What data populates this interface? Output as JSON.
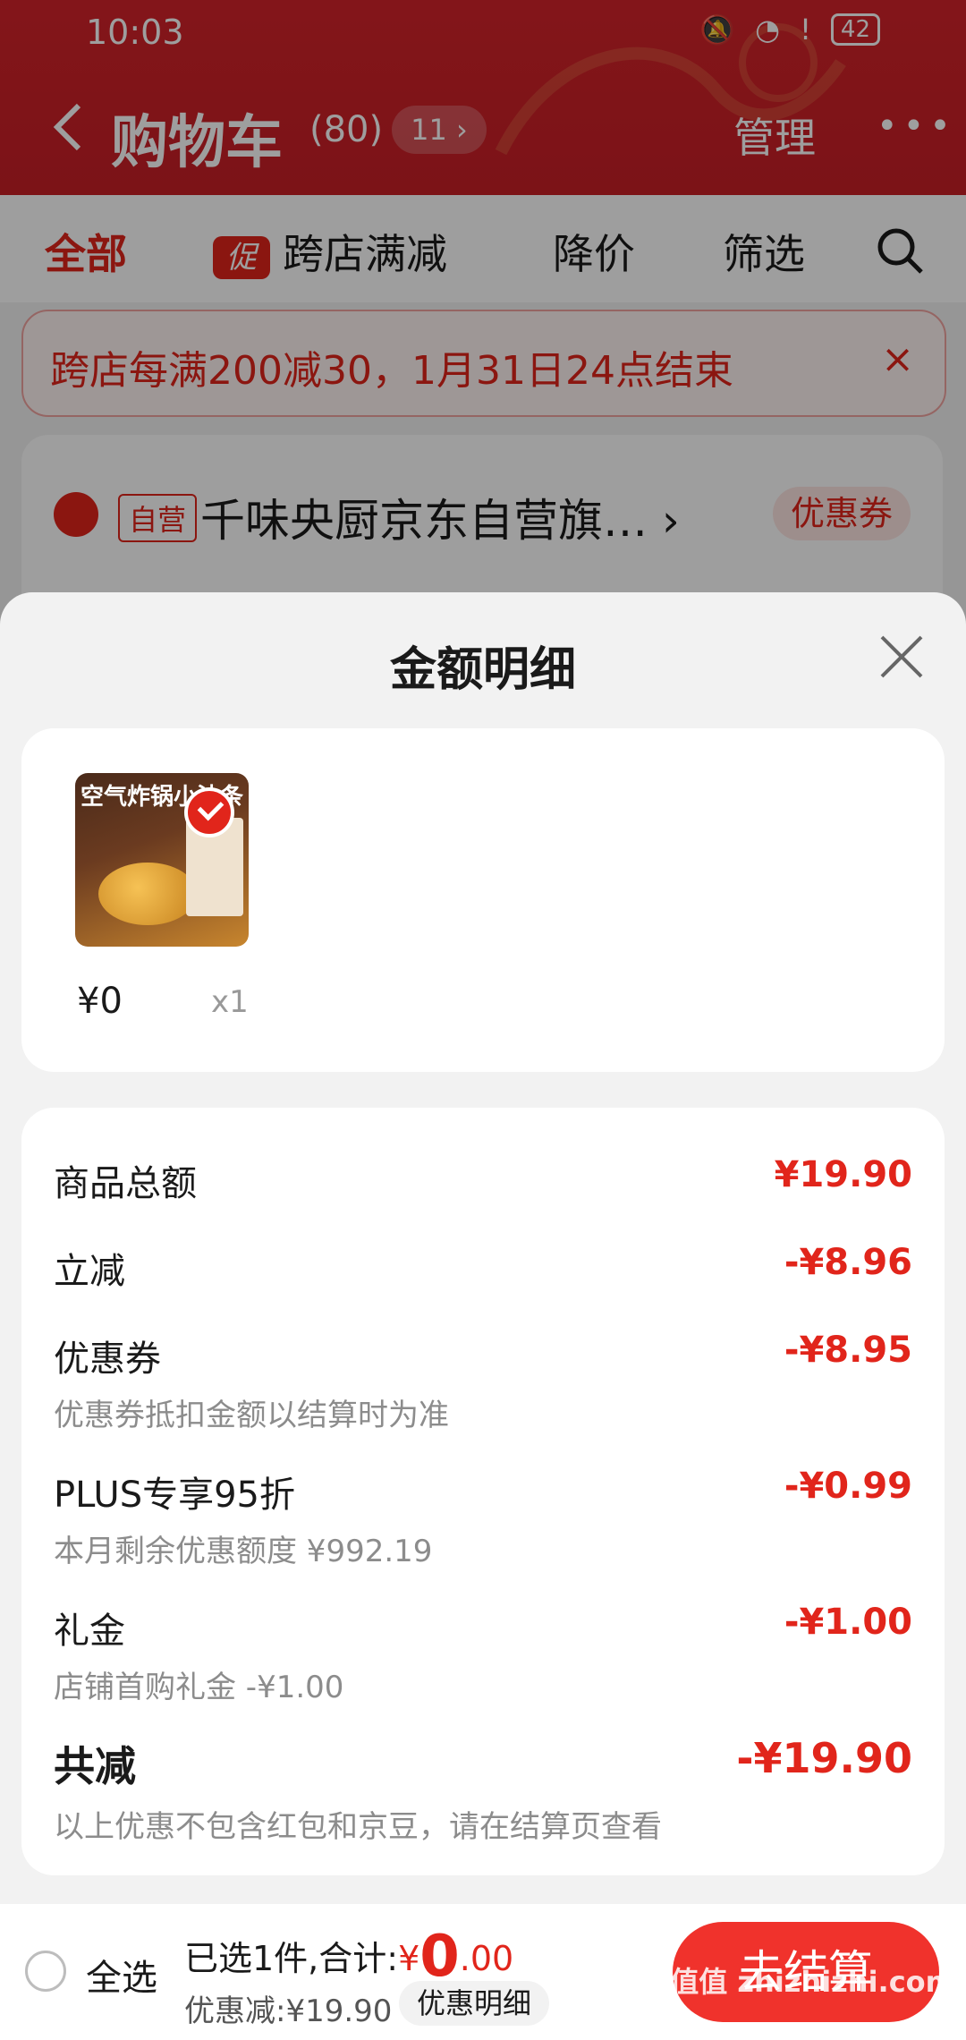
{
  "status_bar": {
    "time": "10:03",
    "battery": "42"
  },
  "nav": {
    "title": "购物车",
    "count": "(80)",
    "pill": "11 ›",
    "manage": "管理",
    "more": "•••"
  },
  "tabs": {
    "all": "全部",
    "promo_badge": "促",
    "cross_store": "跨店满减",
    "price_drop": "降价",
    "filter": "筛选"
  },
  "notice": {
    "text": "跨店每满200减30，1月31日24点结束",
    "close": "×"
  },
  "store": {
    "self_badge": "自营",
    "name": "千味央厨京东自营旗…",
    "arrow": "›",
    "coupon": "优惠券"
  },
  "sheet": {
    "title": "金额明细",
    "product": {
      "image_banner": "空气炸锅小油条",
      "price": "¥0",
      "qty": "x1"
    },
    "rows": [
      {
        "label": "商品总额",
        "amount": "¥19.90",
        "sub": ""
      },
      {
        "label": "立减",
        "amount": "-¥8.96",
        "sub": ""
      },
      {
        "label": "优惠券",
        "amount": "-¥8.95",
        "sub": "优惠券抵扣金额以结算时为准"
      },
      {
        "label": "PLUS专享95折",
        "amount": "-¥0.99",
        "sub": "本月剩余优惠额度 ¥992.19"
      },
      {
        "label": "礼金",
        "amount": "-¥1.00",
        "sub": "店铺首购礼金 -¥1.00"
      }
    ],
    "total": {
      "label": "共减",
      "amount": "-¥19.90",
      "sub": "以上优惠不包含红包和京豆，请在结算页查看"
    }
  },
  "bottom": {
    "select_all": "全选",
    "summary_prefix": "已选1件,合计:",
    "currency": "¥",
    "price_int": "0",
    "price_dec": ".00",
    "discount": "优惠减:¥19.90",
    "detail_pill": "优惠明细",
    "checkout": "去结算",
    "watermark": "值值值 zhizhizhi.com"
  },
  "colors": {
    "accent": "#e1251b",
    "header": "#d4232a"
  }
}
